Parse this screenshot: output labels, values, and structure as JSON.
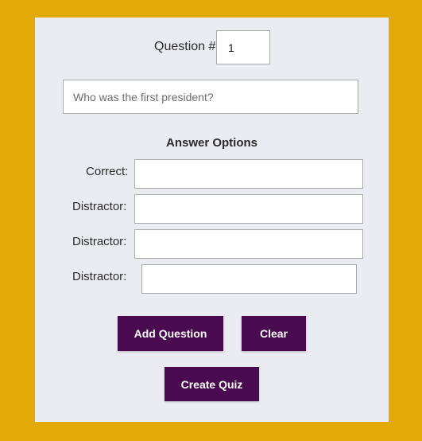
{
  "colors": {
    "background": "#e3a906",
    "panel": "#ebebf2",
    "button": "#4a0a4f"
  },
  "question_number": {
    "label": "Question #:",
    "value": "1"
  },
  "question": {
    "placeholder": "Who was the first president?"
  },
  "answers": {
    "heading": "Answer Options",
    "correct_label": "Correct:",
    "distractor_label": "Distractor:"
  },
  "buttons": {
    "add_question": "Add Question",
    "clear": "Clear",
    "create_quiz": "Create Quiz"
  }
}
